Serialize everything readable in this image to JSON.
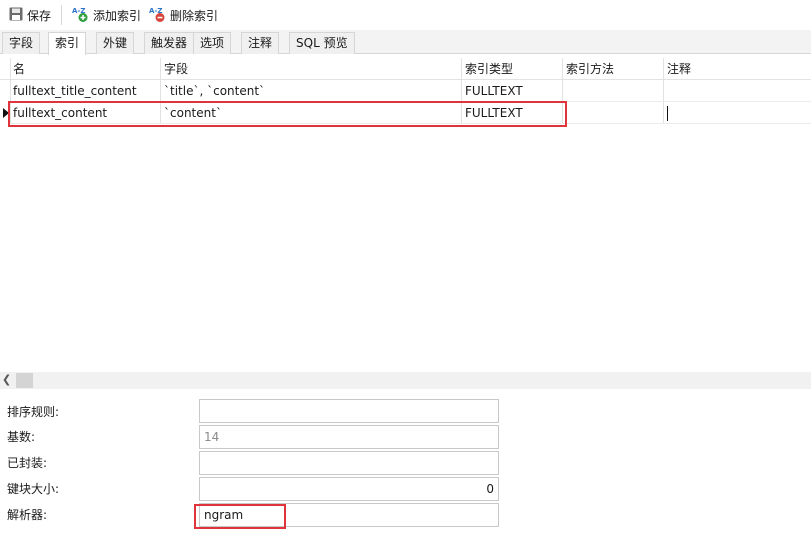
{
  "toolbar": {
    "save_label": "保存",
    "add_index_label": "添加索引",
    "delete_index_label": "删除索引"
  },
  "tabs": [
    {
      "label": "字段",
      "active": false
    },
    {
      "label": "索引",
      "active": true
    },
    {
      "label": "外键",
      "active": false
    },
    {
      "label": "触发器",
      "active": false
    },
    {
      "label": "选项",
      "active": false
    },
    {
      "label": "注释",
      "active": false
    },
    {
      "label": "SQL 预览",
      "active": false
    }
  ],
  "grid": {
    "columns": [
      "名",
      "字段",
      "索引类型",
      "索引方法",
      "注释"
    ],
    "rows": [
      {
        "name": "fulltext_title_content",
        "fields": "`title`, `content`",
        "index_type": "FULLTEXT",
        "index_method": "",
        "comment": ""
      },
      {
        "name": "fulltext_content",
        "fields": "`content`",
        "index_type": "FULLTEXT",
        "index_method": "",
        "comment": ""
      }
    ],
    "selected_row": 1
  },
  "properties": {
    "collation": {
      "label": "排序规则:",
      "value": ""
    },
    "cardinality": {
      "label": "基数:",
      "value": "14"
    },
    "packed": {
      "label": "已封装:",
      "value": ""
    },
    "key_block_size": {
      "label": "键块大小:",
      "value": "0"
    },
    "parser": {
      "label": "解析器:",
      "value": "ngram"
    }
  },
  "colors": {
    "highlight": "#e0343c",
    "add_icon": "#2e9e3e",
    "delete_icon": "#d9443a",
    "az_icon": "#2a73c8"
  }
}
